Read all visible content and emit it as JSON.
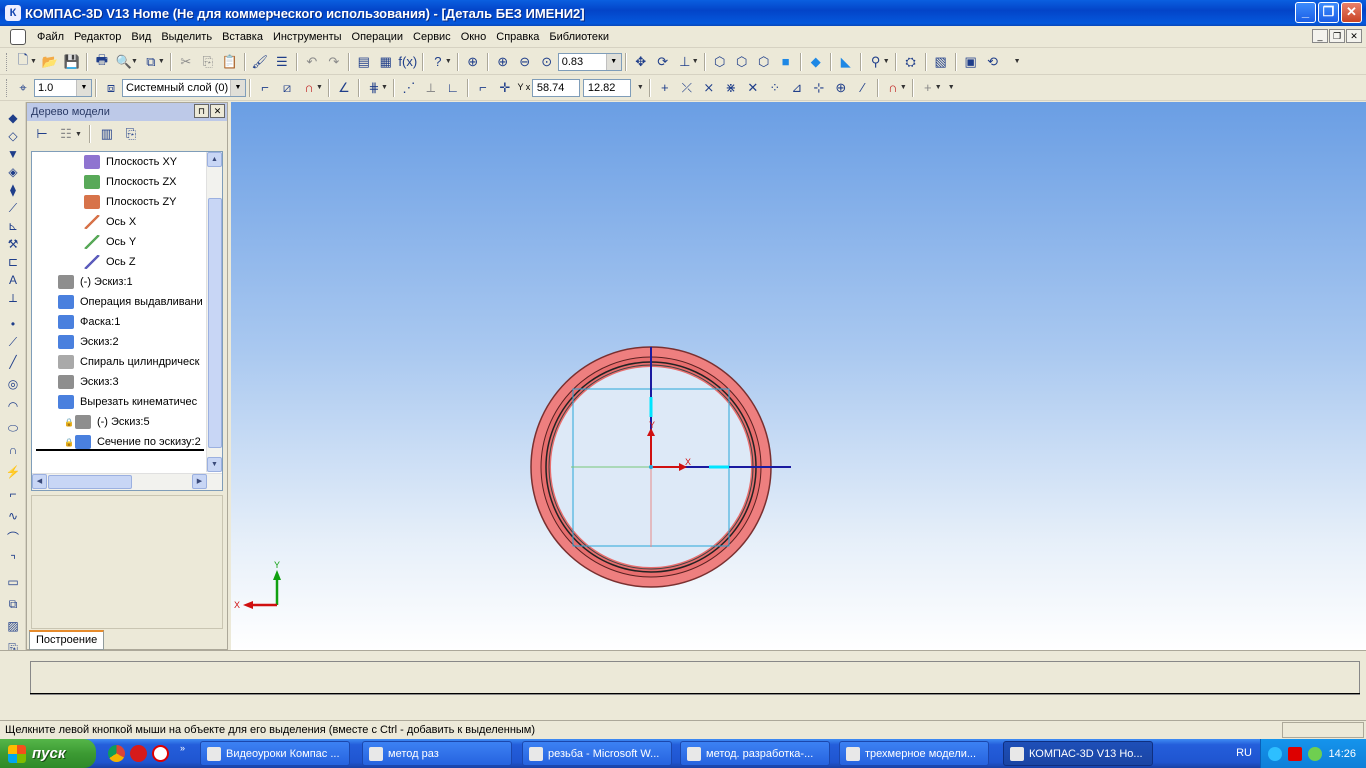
{
  "window": {
    "title": "КОМПАС-3D V13 Home (Не для коммерческого использования) - [Деталь БЕЗ ИМЕНИ2]",
    "app_icon_letter": "К"
  },
  "menu": [
    "Файл",
    "Редактор",
    "Вид",
    "Выделить",
    "Вставка",
    "Инструменты",
    "Операции",
    "Сервис",
    "Окно",
    "Справка",
    "Библиотеки"
  ],
  "toolbar1": {
    "zoom_value": "0.83"
  },
  "toolbar2": {
    "line_width": "1.0",
    "layer": "Системный слой (0)",
    "coord_x": "58.74",
    "coord_y": "12.82",
    "coord_label": "Y x"
  },
  "model_tree": {
    "title": "Дерево модели",
    "items": [
      {
        "label": "Плоскость XY",
        "icon": "plane-xy-icon",
        "color": "#7b5cc8"
      },
      {
        "label": "Плоскость ZX",
        "icon": "plane-zx-icon",
        "color": "#3c9a3c"
      },
      {
        "label": "Плоскость ZY",
        "icon": "plane-zy-icon",
        "color": "#d05a2a"
      },
      {
        "label": "Ось X",
        "icon": "axis-x-icon",
        "color": "#d05a2a"
      },
      {
        "label": "Ось Y",
        "icon": "axis-y-icon",
        "color": "#3c9a3c"
      },
      {
        "label": "Ось Z",
        "icon": "axis-z-icon",
        "color": "#4040b0"
      },
      {
        "label": "(-)  Эскиз:1",
        "icon": "sketch-icon",
        "color": "#7a7a7a"
      },
      {
        "label": "Операция выдавливани",
        "icon": "extrude-icon",
        "color": "#2a6ad8"
      },
      {
        "label": "Фаска:1",
        "icon": "chamfer-icon",
        "color": "#2a6ad8"
      },
      {
        "label": "Эскиз:2",
        "icon": "sketch-icon",
        "color": "#2a6ad8"
      },
      {
        "label": "Спираль цилиндрическ",
        "icon": "spiral-icon",
        "color": "#9a9a9a"
      },
      {
        "label": "Эскиз:3",
        "icon": "sketch-icon",
        "color": "#7a7a7a"
      },
      {
        "label": "Вырезать кинематичес",
        "icon": "cut-icon",
        "color": "#2a6ad8"
      },
      {
        "label": "(-)  Эскиз:5",
        "icon": "sketch-icon",
        "color": "#7a7a7a"
      },
      {
        "label": "Сечение по эскизу:2",
        "icon": "section-icon",
        "color": "#2a6ad8"
      }
    ],
    "tab": "Построение"
  },
  "viewport": {
    "axis_x_label": "X",
    "axis_y_label": "Y",
    "triad_x_label": "X",
    "triad_y_label": "Y"
  },
  "status": {
    "text": "Щелкните левой кнопкой мыши на объекте для его выделения (вместе с Ctrl - добавить к выделенным)"
  },
  "taskbar": {
    "start": "пуск",
    "tasks": [
      {
        "label": "Видеоуроки Компас ...",
        "active": false
      },
      {
        "label": "метод раз",
        "active": false
      },
      {
        "label": "резьба - Microsoft W...",
        "active": false
      },
      {
        "label": "метод. разработка-...",
        "active": false
      },
      {
        "label": "трехмерное модели...",
        "active": false
      },
      {
        "label": "КОМПАС-3D V13 Ho...",
        "active": true
      }
    ],
    "lang": "RU",
    "clock": "14:26"
  }
}
